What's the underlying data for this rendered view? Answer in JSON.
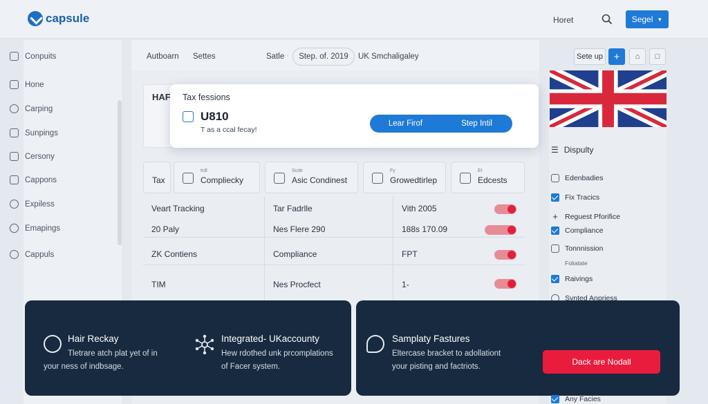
{
  "app": {
    "name": "capsule",
    "brand_color": "#1e7ad6",
    "accent_red": "#ea1c3d"
  },
  "header": {
    "link": "Horet",
    "button": "Segel"
  },
  "sidebar": {
    "items": [
      {
        "label": "Conpuits",
        "icon": "document-icon"
      },
      {
        "label": "Hone",
        "icon": "home-icon"
      },
      {
        "label": "Carping",
        "icon": "clock-icon"
      },
      {
        "label": "Sunpings",
        "icon": "folder-icon"
      },
      {
        "label": "Cersony",
        "icon": "building-icon"
      },
      {
        "label": "Cappons",
        "icon": "clipboard-icon"
      },
      {
        "label": "Expiless",
        "icon": "dollar-icon"
      },
      {
        "label": "Emapings",
        "icon": "link-icon"
      },
      {
        "label": "Cappuls",
        "icon": "eye-icon"
      }
    ]
  },
  "breadcrumb": {
    "a": "Autboarn",
    "b": "Settes",
    "c": "Satle",
    "pill": "Step. of. 2019",
    "d": "UK Smchaligaley"
  },
  "toolbar": {
    "setup": "Sete up",
    "plus": "+"
  },
  "card": {
    "label": "HAF"
  },
  "modal": {
    "title": "Tax fessions",
    "code": "U810",
    "sub": "T as a ccal fecay!",
    "btn_left": "Lear Firof",
    "btn_right": "Step Intil"
  },
  "tabs": [
    {
      "label": "Tax",
      "small": ""
    },
    {
      "label": "Compliecky",
      "small": "trdl"
    },
    {
      "label": "Asic Condinest",
      "small": "Scde"
    },
    {
      "label": "Growedtirlep",
      "small": "Fy"
    },
    {
      "label": "Edcests",
      "small": "Et"
    }
  ],
  "table": {
    "rows": [
      {
        "c1": "Veart Tracking",
        "c2": "Tar Fadrlle",
        "c3": "Vith 2005"
      },
      {
        "c1": "20 Paly",
        "c2": "Nes Flere 290",
        "c3": "188s 170.09"
      },
      {
        "c1": "ZK Contiens",
        "c2": "Compliance",
        "c3": "FPT"
      },
      {
        "c1": "TIM",
        "c2": "Nes Procfect",
        "c3": "1-"
      }
    ]
  },
  "right_panel": {
    "heading": "Dispulty",
    "sub_heading": "Edenbadies",
    "items": [
      {
        "label": "Fix Tracics",
        "kind": "check"
      },
      {
        "label": "Reguest Pforifice",
        "kind": "plus"
      },
      {
        "label": "Compliance",
        "kind": "check"
      },
      {
        "label": "Tonnnission",
        "kind": "doc"
      },
      {
        "label": "Raivings",
        "kind": "check"
      },
      {
        "label": "Svnted Anpriess",
        "kind": "clock"
      }
    ],
    "subtext": "Foliatate",
    "bottom": "Any Facies"
  },
  "features": [
    {
      "title": "Hair Reckay",
      "desc1": "Tletrare atch plat yet of in",
      "desc2": "your ness of indbsage.",
      "icon": "people-icon"
    },
    {
      "title": "Integrated- UKaccounty",
      "desc1": "Hew rdothed unk prcomplations",
      "desc2": "of Facer system.",
      "icon": "network-icon"
    },
    {
      "title": "Samplaty Fastures",
      "desc1": "Eltercase bracket to adollationt",
      "desc2": "your pisting and factriots.",
      "icon": "chat-icon"
    }
  ],
  "cta": {
    "label": "Dack are Nodall"
  }
}
